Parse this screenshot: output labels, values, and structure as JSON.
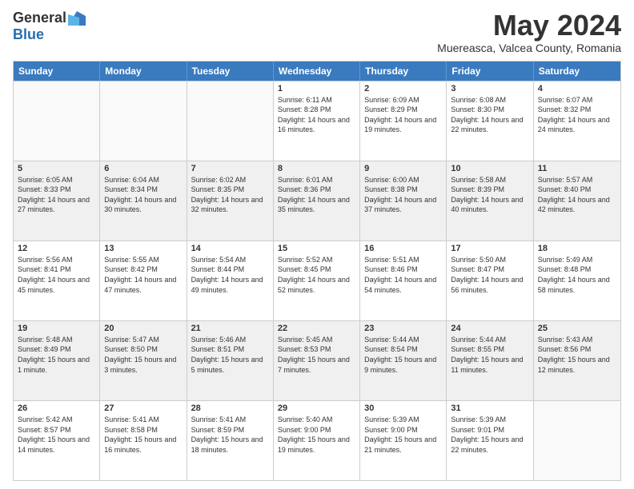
{
  "logo": {
    "general": "General",
    "blue": "Blue"
  },
  "title": "May 2024",
  "subtitle": "Muereasca, Valcea County, Romania",
  "days": [
    "Sunday",
    "Monday",
    "Tuesday",
    "Wednesday",
    "Thursday",
    "Friday",
    "Saturday"
  ],
  "weeks": [
    [
      {
        "day": "",
        "empty": true
      },
      {
        "day": "",
        "empty": true
      },
      {
        "day": "",
        "empty": true
      },
      {
        "day": "1",
        "sunrise": "6:11 AM",
        "sunset": "8:28 PM",
        "daylight": "14 hours and 16 minutes."
      },
      {
        "day": "2",
        "sunrise": "6:09 AM",
        "sunset": "8:29 PM",
        "daylight": "14 hours and 19 minutes."
      },
      {
        "day": "3",
        "sunrise": "6:08 AM",
        "sunset": "8:30 PM",
        "daylight": "14 hours and 22 minutes."
      },
      {
        "day": "4",
        "sunrise": "6:07 AM",
        "sunset": "8:32 PM",
        "daylight": "14 hours and 24 minutes."
      }
    ],
    [
      {
        "day": "5",
        "sunrise": "6:05 AM",
        "sunset": "8:33 PM",
        "daylight": "14 hours and 27 minutes."
      },
      {
        "day": "6",
        "sunrise": "6:04 AM",
        "sunset": "8:34 PM",
        "daylight": "14 hours and 30 minutes."
      },
      {
        "day": "7",
        "sunrise": "6:02 AM",
        "sunset": "8:35 PM",
        "daylight": "14 hours and 32 minutes."
      },
      {
        "day": "8",
        "sunrise": "6:01 AM",
        "sunset": "8:36 PM",
        "daylight": "14 hours and 35 minutes."
      },
      {
        "day": "9",
        "sunrise": "6:00 AM",
        "sunset": "8:38 PM",
        "daylight": "14 hours and 37 minutes."
      },
      {
        "day": "10",
        "sunrise": "5:58 AM",
        "sunset": "8:39 PM",
        "daylight": "14 hours and 40 minutes."
      },
      {
        "day": "11",
        "sunrise": "5:57 AM",
        "sunset": "8:40 PM",
        "daylight": "14 hours and 42 minutes."
      }
    ],
    [
      {
        "day": "12",
        "sunrise": "5:56 AM",
        "sunset": "8:41 PM",
        "daylight": "14 hours and 45 minutes."
      },
      {
        "day": "13",
        "sunrise": "5:55 AM",
        "sunset": "8:42 PM",
        "daylight": "14 hours and 47 minutes."
      },
      {
        "day": "14",
        "sunrise": "5:54 AM",
        "sunset": "8:44 PM",
        "daylight": "14 hours and 49 minutes."
      },
      {
        "day": "15",
        "sunrise": "5:52 AM",
        "sunset": "8:45 PM",
        "daylight": "14 hours and 52 minutes."
      },
      {
        "day": "16",
        "sunrise": "5:51 AM",
        "sunset": "8:46 PM",
        "daylight": "14 hours and 54 minutes."
      },
      {
        "day": "17",
        "sunrise": "5:50 AM",
        "sunset": "8:47 PM",
        "daylight": "14 hours and 56 minutes."
      },
      {
        "day": "18",
        "sunrise": "5:49 AM",
        "sunset": "8:48 PM",
        "daylight": "14 hours and 58 minutes."
      }
    ],
    [
      {
        "day": "19",
        "sunrise": "5:48 AM",
        "sunset": "8:49 PM",
        "daylight": "15 hours and 1 minute."
      },
      {
        "day": "20",
        "sunrise": "5:47 AM",
        "sunset": "8:50 PM",
        "daylight": "15 hours and 3 minutes."
      },
      {
        "day": "21",
        "sunrise": "5:46 AM",
        "sunset": "8:51 PM",
        "daylight": "15 hours and 5 minutes."
      },
      {
        "day": "22",
        "sunrise": "5:45 AM",
        "sunset": "8:53 PM",
        "daylight": "15 hours and 7 minutes."
      },
      {
        "day": "23",
        "sunrise": "5:44 AM",
        "sunset": "8:54 PM",
        "daylight": "15 hours and 9 minutes."
      },
      {
        "day": "24",
        "sunrise": "5:44 AM",
        "sunset": "8:55 PM",
        "daylight": "15 hours and 11 minutes."
      },
      {
        "day": "25",
        "sunrise": "5:43 AM",
        "sunset": "8:56 PM",
        "daylight": "15 hours and 12 minutes."
      }
    ],
    [
      {
        "day": "26",
        "sunrise": "5:42 AM",
        "sunset": "8:57 PM",
        "daylight": "15 hours and 14 minutes."
      },
      {
        "day": "27",
        "sunrise": "5:41 AM",
        "sunset": "8:58 PM",
        "daylight": "15 hours and 16 minutes."
      },
      {
        "day": "28",
        "sunrise": "5:41 AM",
        "sunset": "8:59 PM",
        "daylight": "15 hours and 18 minutes."
      },
      {
        "day": "29",
        "sunrise": "5:40 AM",
        "sunset": "9:00 PM",
        "daylight": "15 hours and 19 minutes."
      },
      {
        "day": "30",
        "sunrise": "5:39 AM",
        "sunset": "9:00 PM",
        "daylight": "15 hours and 21 minutes."
      },
      {
        "day": "31",
        "sunrise": "5:39 AM",
        "sunset": "9:01 PM",
        "daylight": "15 hours and 22 minutes."
      },
      {
        "day": "",
        "empty": true
      }
    ]
  ]
}
